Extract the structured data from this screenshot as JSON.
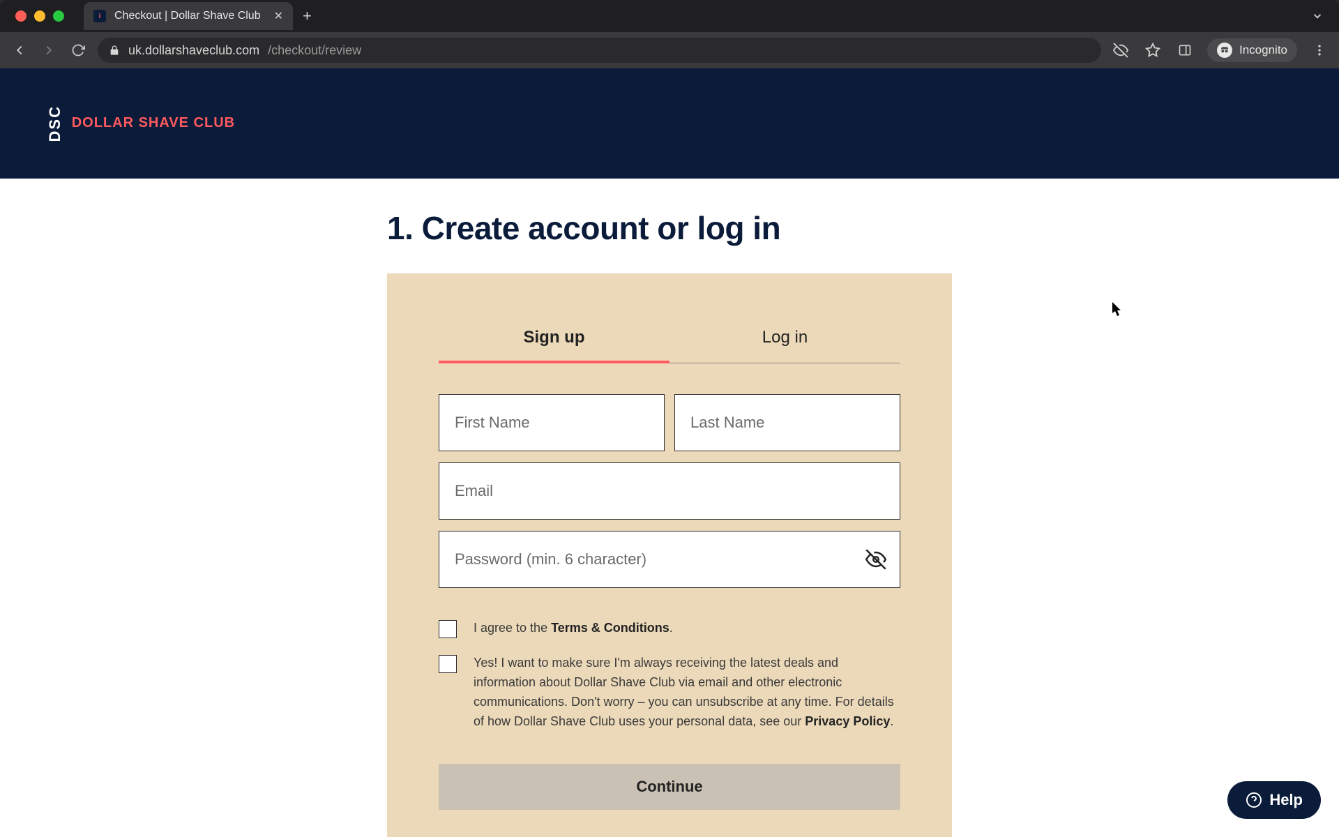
{
  "browser": {
    "tab_title": "Checkout | Dollar Shave Club",
    "url_host": "uk.dollarshaveclub.com",
    "url_path": "/checkout/review",
    "incognito_label": "Incognito"
  },
  "header": {
    "logo_mark": "DSC",
    "brand": "DOLLAR SHAVE CLUB"
  },
  "step": {
    "title": "1. Create account or log in"
  },
  "tabs": {
    "signup": "Sign up",
    "login": "Log in",
    "active": "signup"
  },
  "form": {
    "first_name_placeholder": "First Name",
    "last_name_placeholder": "Last Name",
    "email_placeholder": "Email",
    "password_placeholder": "Password (min. 6 character)",
    "first_name_value": "",
    "last_name_value": "",
    "email_value": "",
    "password_value": ""
  },
  "terms": {
    "prefix": "I agree to the ",
    "link": "Terms & Conditions",
    "suffix": "."
  },
  "marketing": {
    "prefix": "Yes! I want to make sure I'm always receiving the latest deals and information about Dollar Shave Club via email and other electronic communications. Don't worry – you can unsubscribe at any time. For details of how Dollar Shave Club uses your personal data, see our ",
    "link": "Privacy Policy",
    "suffix": "."
  },
  "cta": {
    "continue": "Continue"
  },
  "help": {
    "label": "Help"
  },
  "colors": {
    "brand_navy": "#0b1b3a",
    "brand_coral": "#ff5a5f",
    "card_bg": "#ecd9b9"
  }
}
